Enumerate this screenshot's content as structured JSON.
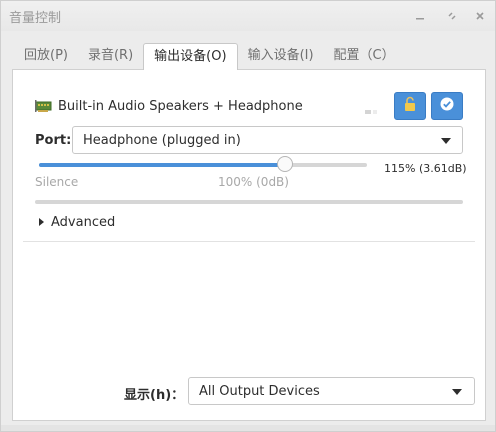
{
  "window": {
    "title": "音量控制",
    "minimize_icon": "minimize-icon",
    "maximize_icon": "restore-icon",
    "close_icon": "close-icon"
  },
  "tabs": [
    {
      "label": "回放(P)",
      "active": false
    },
    {
      "label": "录音(R)",
      "active": false
    },
    {
      "label": "输出设备(O)",
      "active": true
    },
    {
      "label": "输入设备(I)",
      "active": false
    },
    {
      "label": "配置（C）",
      "active": false
    }
  ],
  "device": {
    "name": "Built-in Audio Speakers + Headphone",
    "icon": "sound-card-icon",
    "lock_icon": "lock-icon",
    "default_icon": "checkmark-icon",
    "port_label": "Port:",
    "port_value": "Headphone (plugged in)",
    "volume_fraction_of_slider": 0.75,
    "volume_readout": "115% (3.61dB)",
    "tick_silence": "Silence",
    "tick_100": "100% (0dB)",
    "peak_meter_level": 0,
    "advanced_label": "Advanced"
  },
  "footer": {
    "show_label": "显示(h)：",
    "show_value": "All Output Devices"
  },
  "colors": {
    "accent": "#4a90d9",
    "track": "#d6d6d6",
    "tick_text": "#a8a8a8"
  }
}
